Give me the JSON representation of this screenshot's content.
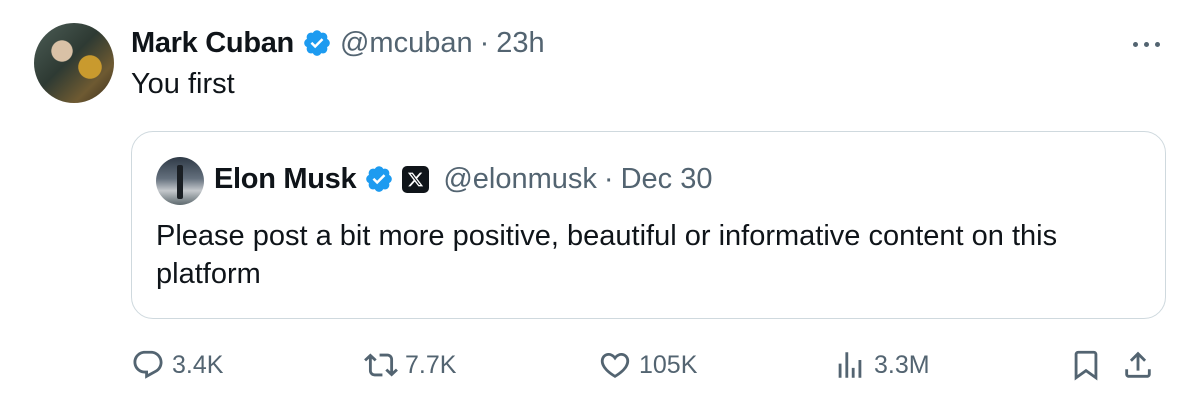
{
  "tweet": {
    "author_name": "Mark Cuban",
    "handle": "@mcuban",
    "separator": "·",
    "time": "23h",
    "text": "You first"
  },
  "quoted": {
    "author_name": "Elon Musk",
    "handle": "@elonmusk",
    "separator": "·",
    "date": "Dec 30",
    "text": "Please post a bit more positive, beautiful or informative content on this platform"
  },
  "actions": {
    "replies": "3.4K",
    "reposts": "7.7K",
    "likes": "105K",
    "views": "3.3M"
  },
  "icons": {
    "verified": "verified-badge-icon",
    "affiliate": "x-logo-icon",
    "more": "more-icon",
    "reply": "reply-icon",
    "repost": "repost-icon",
    "like": "heart-icon",
    "views": "views-icon",
    "bookmark": "bookmark-icon",
    "share": "share-icon"
  },
  "colors": {
    "verified": "#1d9bf0",
    "text": "#0f1419",
    "secondary": "#536471",
    "border": "#cfd9de"
  }
}
